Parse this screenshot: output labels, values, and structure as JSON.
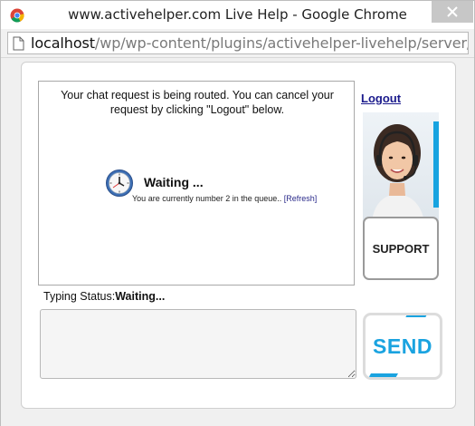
{
  "window": {
    "title": "www.activehelper.com Live Help - Google Chrome",
    "url_host": "localhost",
    "url_path": "/wp/wp-content/plugins/activehelper-livehelp/server/frames"
  },
  "chat": {
    "routed_message": "Your chat request is being routed. You can cancel your request by clicking \"Logout\" below.",
    "waiting_title": "Waiting ...",
    "queue_text": "You are currently number 2 in the queue.. ",
    "refresh_label": "[Refresh]"
  },
  "sidebar": {
    "logout_label": "Logout",
    "support_label": "SUPPORT"
  },
  "typing": {
    "label": "Typing Status:",
    "value": "Waiting..."
  },
  "composer": {
    "message_value": "",
    "send_label": "SEND"
  },
  "colors": {
    "accent": "#1aa3e0",
    "link": "#1a1a8c"
  }
}
